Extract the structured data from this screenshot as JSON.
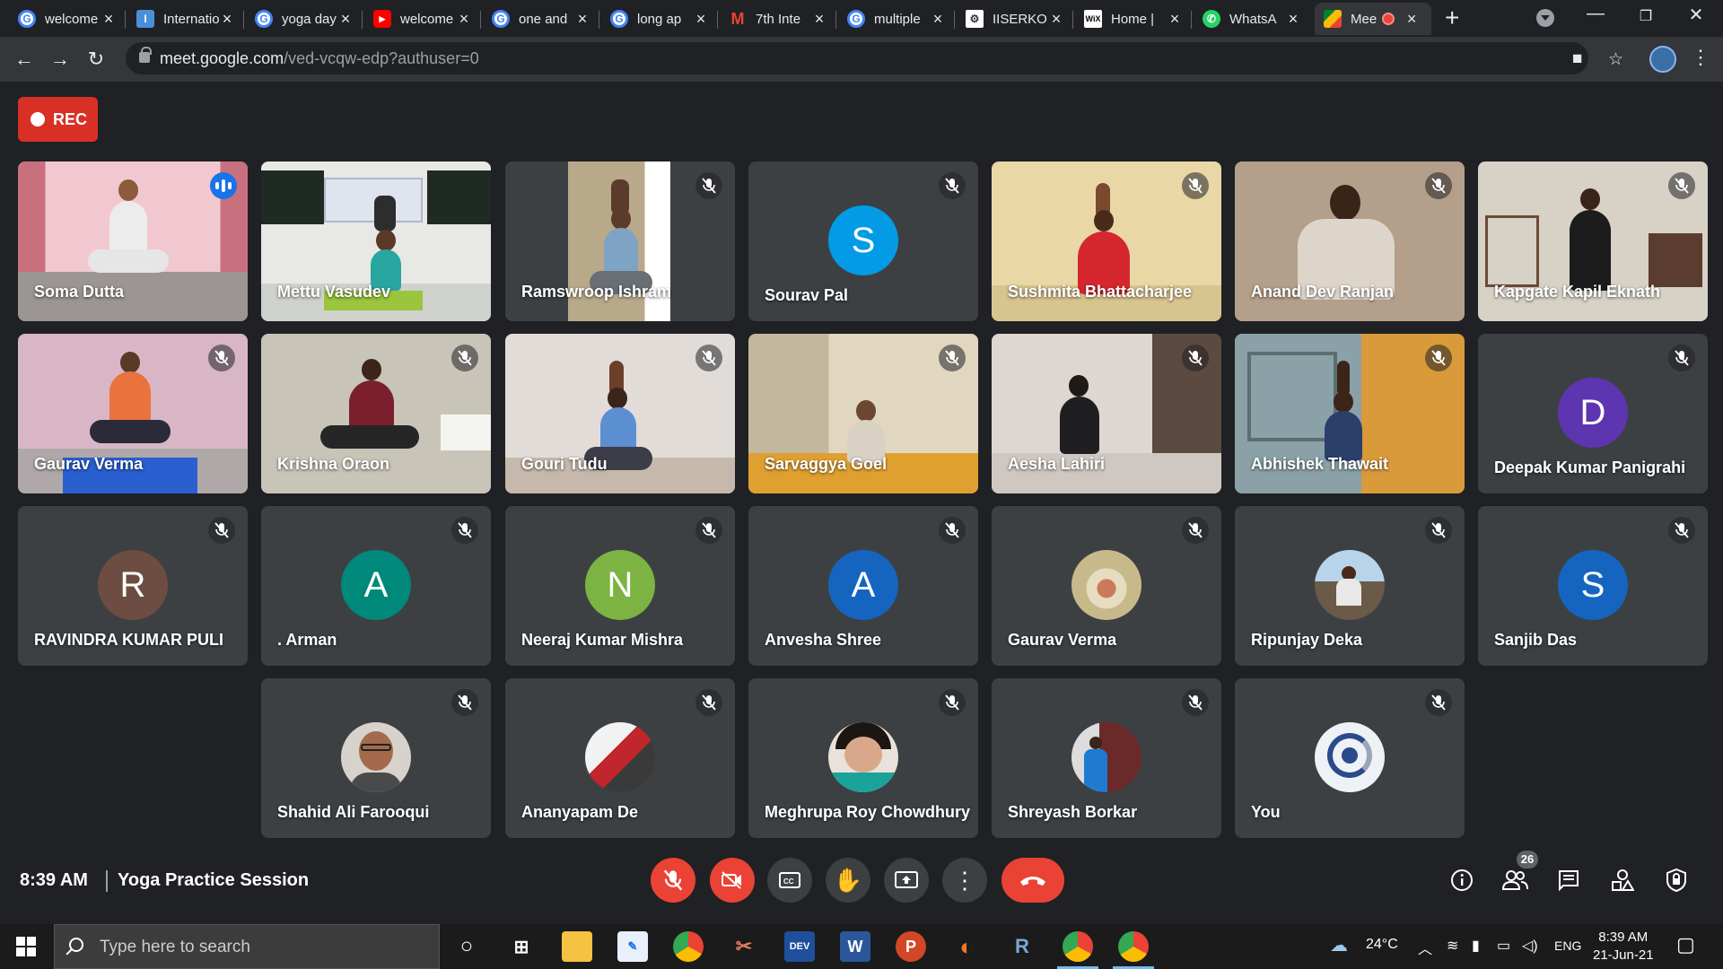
{
  "browser": {
    "tabs": [
      {
        "title": "welcome",
        "favicon": "google-icon"
      },
      {
        "title": "International",
        "favicon": "site-icon"
      },
      {
        "title": "yoga day",
        "favicon": "google-icon"
      },
      {
        "title": "welcome",
        "favicon": "youtube-icon"
      },
      {
        "title": "one and",
        "favicon": "google-icon"
      },
      {
        "title": "long ap",
        "favicon": "google-icon"
      },
      {
        "title": "7th Inte",
        "favicon": "gmail-icon"
      },
      {
        "title": "multiple",
        "favicon": "google-icon"
      },
      {
        "title": "IISERKO",
        "favicon": "iiser-icon"
      },
      {
        "title": "Home |",
        "favicon": "wix-icon"
      },
      {
        "title": "WhatsA",
        "favicon": "whatsapp-icon"
      },
      {
        "title": "Mee",
        "favicon": "meet-icon"
      }
    ],
    "new_tab": "+",
    "url_host": "meet.google.com",
    "url_path": "/ved-vcqw-edp?authuser=0"
  },
  "meet": {
    "rec_label": "REC",
    "participants": [
      {
        "name": "Soma Dutta"
      },
      {
        "name": "Mettu Vasudev"
      },
      {
        "name": "Ramswroop Ishram"
      },
      {
        "name": "Sourav Pal",
        "initial": "S"
      },
      {
        "name": "Sushmita Bhattacharjee"
      },
      {
        "name": "Anand Dev Ranjan"
      },
      {
        "name": "Kapgate Kapil Eknath"
      },
      {
        "name": "Gaurav Verma"
      },
      {
        "name": "Krishna Oraon"
      },
      {
        "name": "Gouri Tudu"
      },
      {
        "name": "Sarvaggya Goel"
      },
      {
        "name": "Aesha Lahiri"
      },
      {
        "name": "Abhishek Thawait"
      },
      {
        "name": "Deepak Kumar Panigrahi",
        "initial": "D"
      },
      {
        "name": "RAVINDRA KUMAR PULI",
        "initial": "R"
      },
      {
        "name": ". Arman",
        "initial": "A"
      },
      {
        "name": "Neeraj Kumar Mishra",
        "initial": "N"
      },
      {
        "name": "Anvesha Shree",
        "initial": "A"
      },
      {
        "name": "Gaurav Verma"
      },
      {
        "name": "Ripunjay Deka"
      },
      {
        "name": "Sanjib Das",
        "initial": "S"
      },
      {
        "name": "Shahid Ali Farooqui"
      },
      {
        "name": "Ananyapam De"
      },
      {
        "name": "Meghrupa Roy Chowdhury"
      },
      {
        "name": "Shreyash Borkar"
      },
      {
        "name": "You"
      }
    ],
    "avatar_colors": {
      "sourav": "#039be5",
      "deepak": "#5e35b1",
      "ravindra": "#6d4c41",
      "arman": "#00897b",
      "neeraj": "#7cb342",
      "anvesha": "#1565c0",
      "sanjib": "#1565c0"
    },
    "time": "8:39 AM",
    "meeting_title": "Yoga Practice Session",
    "participant_count": "26",
    "controls": [
      "mic-off-icon",
      "camera-off-icon",
      "captions-icon",
      "raise-hand-icon",
      "present-icon",
      "more-options-icon",
      "hang-up-icon"
    ],
    "right_controls": [
      "info-icon",
      "people-icon",
      "chat-icon",
      "activities-icon",
      "host-controls-icon"
    ]
  },
  "taskbar": {
    "search_placeholder": "Type here to search",
    "weather": "24°C",
    "language": "ENG",
    "time": "8:39 AM",
    "date": "21-Jun-21"
  }
}
